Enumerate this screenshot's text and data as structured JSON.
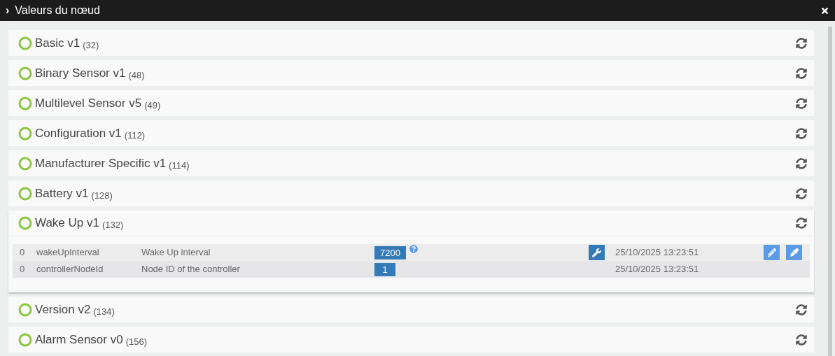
{
  "window": {
    "title": "Valeurs du nœud",
    "expander": "›"
  },
  "sections": [
    {
      "name": "Basic v1",
      "count": "(32)",
      "expanded": false
    },
    {
      "name": "Binary Sensor v1",
      "count": "(48)",
      "expanded": false
    },
    {
      "name": "Multilevel Sensor v5",
      "count": "(49)",
      "expanded": false
    },
    {
      "name": "Configuration v1",
      "count": "(112)",
      "expanded": false
    },
    {
      "name": "Manufacturer Specific v1",
      "count": "(114)",
      "expanded": false
    },
    {
      "name": "Battery v1",
      "count": "(128)",
      "expanded": false
    },
    {
      "name": "Wake Up v1",
      "count": "(132)",
      "expanded": true,
      "rows": [
        {
          "instance": "0",
          "key": "wakeUpInterval",
          "label": "Wake Up interval",
          "value": "7200",
          "help": true,
          "configurable": true,
          "updated": "25/10/2025 13:23:51",
          "editable": true
        },
        {
          "instance": "0",
          "key": "controllerNodeId",
          "label": "Node ID of the controller",
          "value": "1",
          "help": false,
          "configurable": false,
          "updated": "25/10/2025 13:23:51",
          "editable": false
        }
      ]
    },
    {
      "name": "Version v2",
      "count": "(134)",
      "expanded": false
    },
    {
      "name": "Alarm Sensor v0",
      "count": "(156)",
      "expanded": false
    }
  ]
}
